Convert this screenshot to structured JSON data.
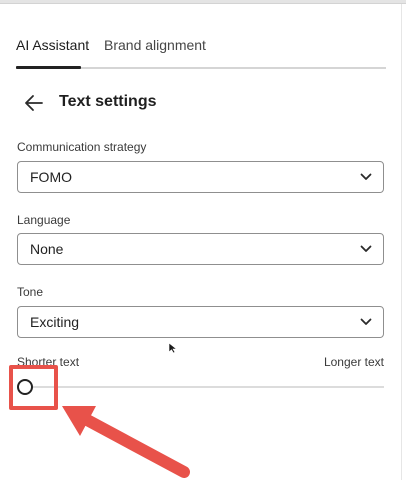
{
  "tabs": [
    {
      "label": "AI Assistant",
      "active": true
    },
    {
      "label": "Brand alignment",
      "active": false
    }
  ],
  "header": {
    "title": "Text settings",
    "back_icon": "arrow-left-icon"
  },
  "fields": {
    "communication_strategy": {
      "label": "Communication strategy",
      "value": "FOMO"
    },
    "language": {
      "label": "Language",
      "value": "None"
    },
    "tone": {
      "label": "Tone",
      "value": "Exciting"
    }
  },
  "length_slider": {
    "min_label": "Shorter text",
    "max_label": "Longer text",
    "value_fraction": 0.0
  },
  "colors": {
    "accent_text": "#222222",
    "annotation_red": "#e8524a",
    "border": "#8f8f8f"
  },
  "icons": {
    "picker_chevron": "chevron-down-icon",
    "mouse": "mouse-pointer-icon"
  }
}
